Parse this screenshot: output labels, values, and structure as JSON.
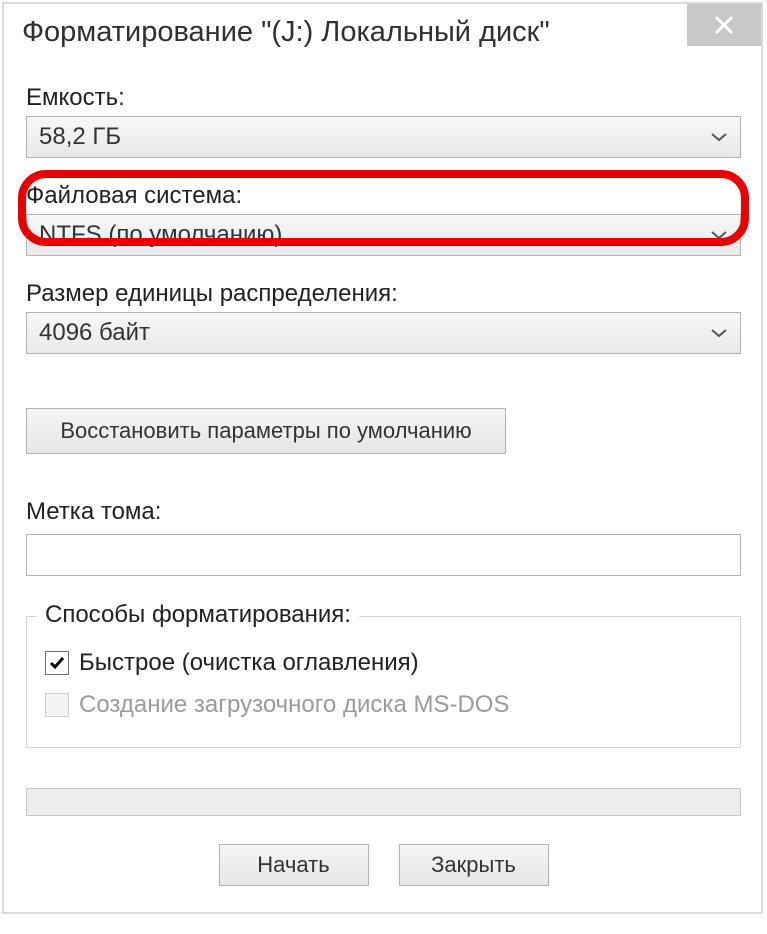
{
  "window": {
    "title": "Форматирование \"(J:) Локальный диск\""
  },
  "labels": {
    "capacity": "Емкость:",
    "filesystem": "Файловая система:",
    "allocation": "Размер единицы распределения:",
    "volume_label": "Метка тома:",
    "format_options": "Способы форматирования:"
  },
  "values": {
    "capacity": "58,2 ГБ",
    "filesystem": "NTFS (по умолчанию)",
    "allocation": "4096 байт",
    "volume_label": ""
  },
  "buttons": {
    "restore_defaults": "Восстановить параметры по умолчанию",
    "start": "Начать",
    "close": "Закрыть"
  },
  "checkboxes": {
    "quick_format": {
      "label": "Быстрое (очистка оглавления)",
      "checked": true,
      "enabled": true
    },
    "msdos_boot": {
      "label": "Создание загрузочного диска MS-DOS",
      "checked": false,
      "enabled": false
    }
  }
}
